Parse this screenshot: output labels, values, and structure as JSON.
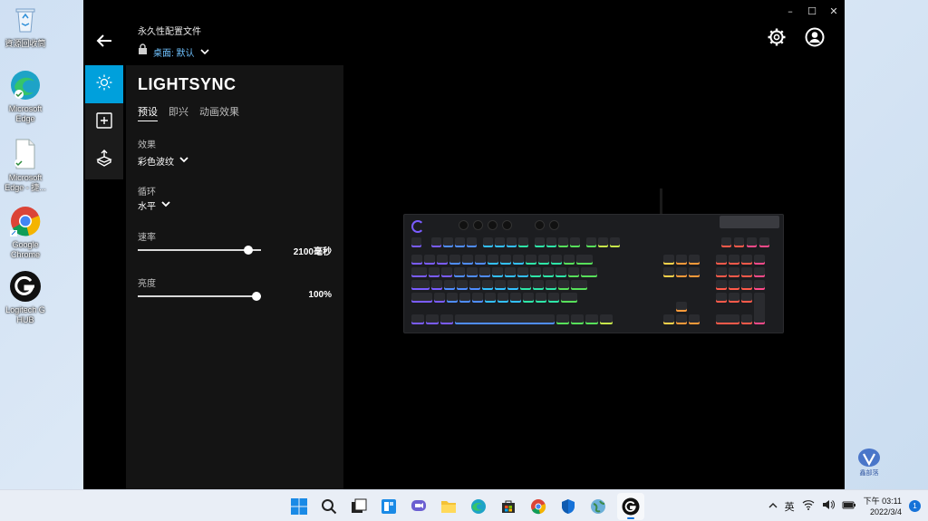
{
  "desktop": {
    "icons": [
      {
        "label": "資源回收筒",
        "icon": "recycle-bin-icon"
      },
      {
        "label": "Microsoft Edge",
        "icon": "edge-icon"
      },
      {
        "label": "Microsoft Edge - 捷...",
        "icon": "document-icon"
      },
      {
        "label": "Google Chrome",
        "icon": "chrome-icon"
      },
      {
        "label": "Logitech G HUB",
        "icon": "logitech-g-icon"
      }
    ]
  },
  "window": {
    "controls": {
      "minimize": "–",
      "maximize": "☐",
      "close": "✕"
    },
    "profile": {
      "title": "永久性配置文件",
      "subtitle": "桌面: 默认"
    },
    "panel": {
      "title": "LIGHTSYNC",
      "tabs": [
        "预设",
        "即兴",
        "动画效果"
      ],
      "effect_label": "效果",
      "effect_value": "彩色波纹",
      "cycle_label": "循环",
      "cycle_value": "水平",
      "rate_label": "速率",
      "rate_value": "2100毫秒",
      "rate_level": 0.93,
      "brightness_label": "亮度",
      "brightness_value": "100%",
      "brightness_level": 1.0
    },
    "accent": "#00a0dc"
  },
  "watermark": {
    "text": "鑫部落"
  },
  "taskbar": {
    "apps": [
      "windows-start-icon",
      "search-icon",
      "task-view-icon",
      "widgets-icon",
      "chat-icon",
      "file-explorer-icon",
      "edge-icon",
      "store-icon",
      "chrome-icon",
      "security-icon",
      "network-globe-icon",
      "logitech-g-hub-icon"
    ],
    "ime": "英",
    "time": "下午 03:11",
    "date": "2022/3/4",
    "notifications": "1"
  }
}
